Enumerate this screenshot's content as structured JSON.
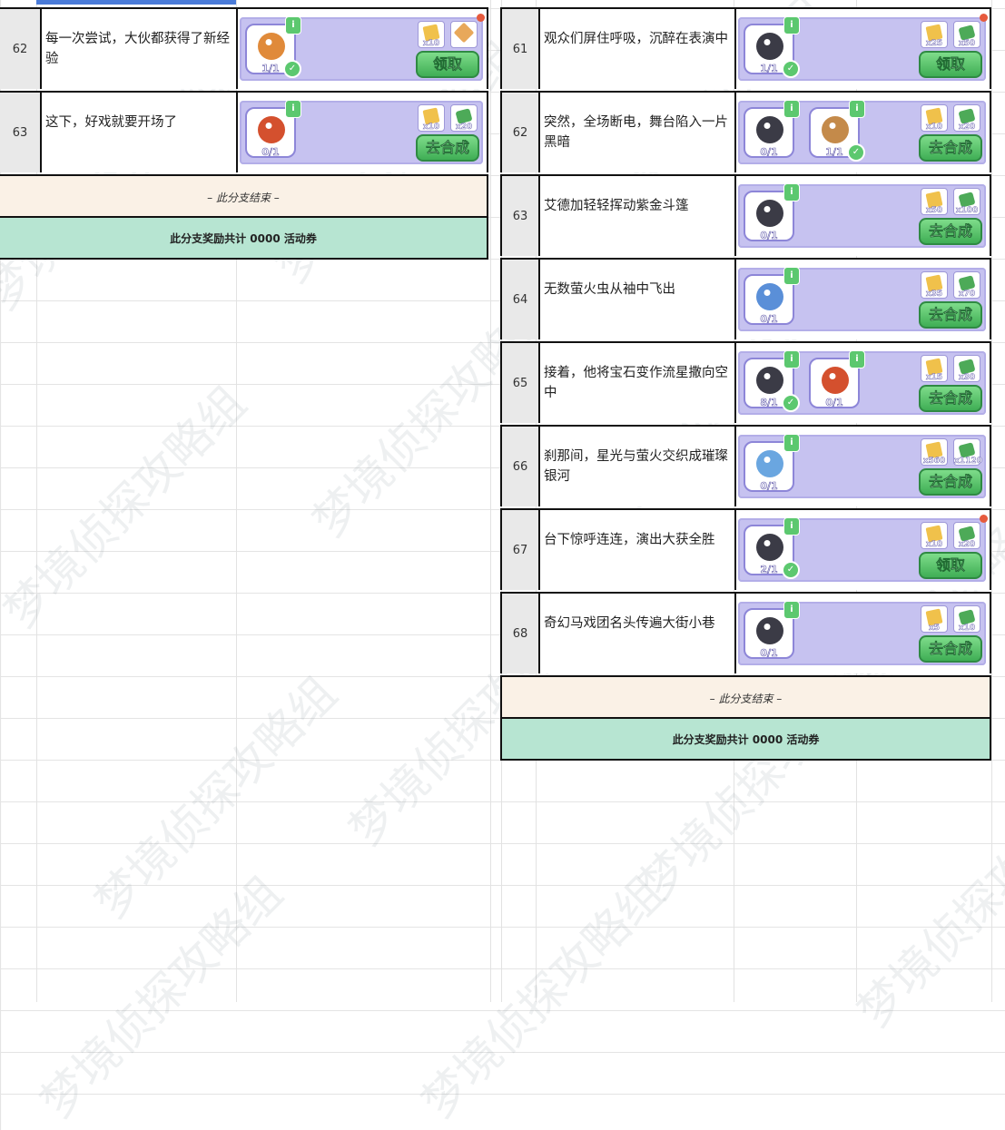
{
  "left": {
    "rows": [
      {
        "num": "62",
        "desc": "每一次尝试，大伙都获得了新经验",
        "items": [
          {
            "count": "1/1",
            "done": true,
            "color": "#e08a3a"
          }
        ],
        "rewards": [
          {
            "kind": "gold",
            "qty": "x10"
          },
          {
            "kind": "special",
            "qty": ""
          }
        ],
        "button": "领取",
        "reddot": true
      },
      {
        "num": "63",
        "desc": "这下，好戏就要开场了",
        "items": [
          {
            "count": "0/1",
            "done": false,
            "color": "#d4502e"
          }
        ],
        "rewards": [
          {
            "kind": "gold",
            "qty": "x10"
          },
          {
            "kind": "money",
            "qty": "x20"
          }
        ],
        "button": "去合成",
        "reddot": false
      }
    ],
    "ending": "– 此分支结束 –",
    "total": "此分支奖励共计 0000 活动券"
  },
  "right": {
    "rows": [
      {
        "num": "61",
        "desc": "观众们屏住呼吸，沉醉在表演中",
        "items": [
          {
            "count": "1/1",
            "done": true,
            "color": "#3b3b46"
          }
        ],
        "rewards": [
          {
            "kind": "gold",
            "qty": "x25"
          },
          {
            "kind": "money",
            "qty": "x50"
          }
        ],
        "button": "领取",
        "reddot": true
      },
      {
        "num": "62",
        "desc": "突然，全场断电，舞台陷入一片黑暗",
        "items": [
          {
            "count": "0/1",
            "done": false,
            "color": "#3b3b46"
          },
          {
            "count": "1/1",
            "done": true,
            "color": "#c48a4a"
          }
        ],
        "rewards": [
          {
            "kind": "gold",
            "qty": "x10"
          },
          {
            "kind": "money",
            "qty": "x20"
          }
        ],
        "button": "去合成",
        "reddot": false
      },
      {
        "num": "63",
        "desc": "艾德加轻轻挥动紫金斗篷",
        "items": [
          {
            "count": "0/1",
            "done": false,
            "color": "#3b3b46"
          }
        ],
        "rewards": [
          {
            "kind": "gold",
            "qty": "x50"
          },
          {
            "kind": "money",
            "qty": "x100"
          }
        ],
        "button": "去合成",
        "reddot": false
      },
      {
        "num": "64",
        "desc": "无数萤火虫从袖中飞出",
        "items": [
          {
            "count": "0/1",
            "done": false,
            "color": "#5a8fd8"
          }
        ],
        "rewards": [
          {
            "kind": "gold",
            "qty": "x35"
          },
          {
            "kind": "money",
            "qty": "x70"
          }
        ],
        "button": "去合成",
        "reddot": false
      },
      {
        "num": "65",
        "desc": "接着，他将宝石变作流星撒向空中",
        "items": [
          {
            "count": "8/1",
            "done": true,
            "color": "#3b3b46"
          },
          {
            "count": "0/1",
            "done": false,
            "color": "#d4502e"
          }
        ],
        "rewards": [
          {
            "kind": "gold",
            "qty": "x15"
          },
          {
            "kind": "money",
            "qty": "x30"
          }
        ],
        "button": "去合成",
        "reddot": false
      },
      {
        "num": "66",
        "desc": "刹那间，星光与萤火交织成璀璨银河",
        "items": [
          {
            "count": "0/1",
            "done": false,
            "color": "#6aa6e0"
          }
        ],
        "rewards": [
          {
            "kind": "gold",
            "qty": "x560"
          },
          {
            "kind": "money",
            "qty": "x1120"
          }
        ],
        "button": "去合成",
        "reddot": false
      },
      {
        "num": "67",
        "desc": "台下惊呼连连，演出大获全胜",
        "items": [
          {
            "count": "2/1",
            "done": true,
            "color": "#3b3b46"
          }
        ],
        "rewards": [
          {
            "kind": "gold",
            "qty": "x10"
          },
          {
            "kind": "money",
            "qty": "x20"
          }
        ],
        "button": "领取",
        "reddot": true
      },
      {
        "num": "68",
        "desc": "奇幻马戏团名头传遍大街小巷",
        "items": [
          {
            "count": "0/1",
            "done": false,
            "color": "#3b3b46"
          }
        ],
        "rewards": [
          {
            "kind": "gold",
            "qty": "x5"
          },
          {
            "kind": "money",
            "qty": "x10"
          }
        ],
        "button": "去合成",
        "reddot": false
      }
    ],
    "ending": "– 此分支结束 –",
    "total": "此分支奖励共计 0000 活动券"
  },
  "watermark": "梦境侦探攻略组",
  "colors": {
    "card": "#c6c2f0",
    "button": "#4cbc60",
    "ending_bg": "#faf1e6",
    "total_bg": "#b7e5d2"
  }
}
